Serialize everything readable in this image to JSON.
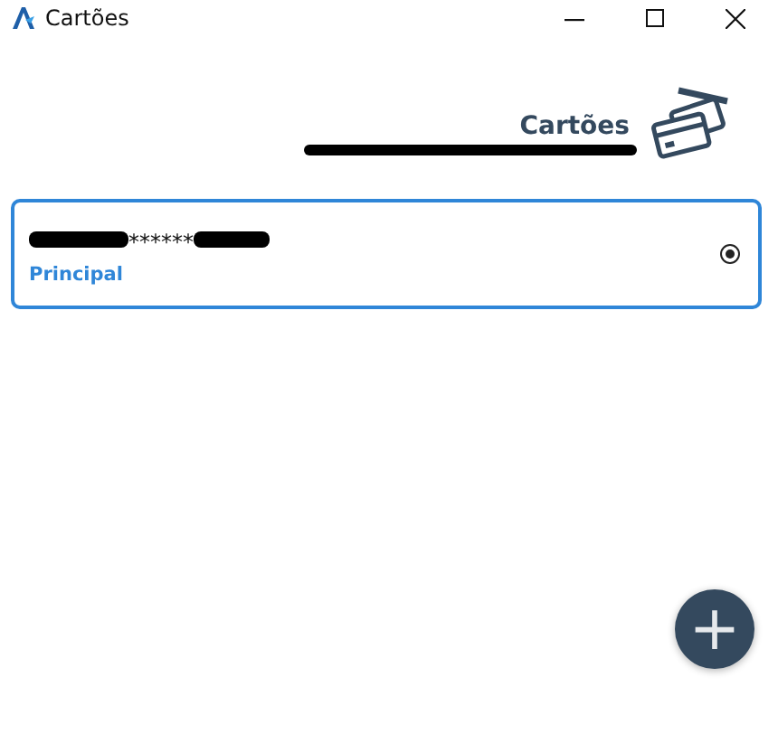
{
  "window": {
    "title": "Cartões"
  },
  "header": {
    "title": "Cartões",
    "subtitle_redacted": true
  },
  "cards": [
    {
      "number": "******",
      "number_redacted_before": true,
      "number_redacted_after": true,
      "label": "Principal",
      "selected": true
    }
  ],
  "add_button": {
    "icon": "+"
  }
}
